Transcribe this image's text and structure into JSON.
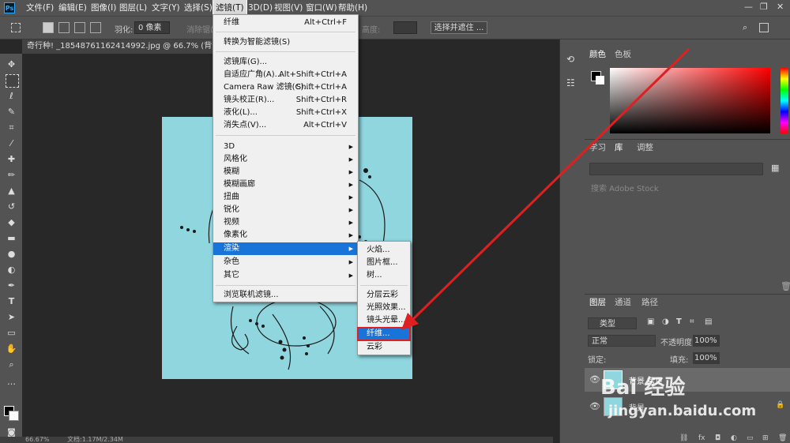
{
  "app": {
    "logo": "Ps"
  },
  "menubar": {
    "items": [
      "文件(F)",
      "编辑(E)",
      "图像(I)",
      "图层(L)",
      "文字(Y)",
      "选择(S)",
      "滤镜(T)",
      "3D(D)",
      "视图(V)",
      "窗口(W)",
      "帮助(H)"
    ],
    "active": "滤镜(T)"
  },
  "options": {
    "feather_label": "羽化:",
    "feather_value": "0 像素",
    "antialias_label": "消除锯齿",
    "style_label": "样式:",
    "width_label": "宽度:",
    "height_label": "高度:",
    "select_mask_button": "选择并遮住 ..."
  },
  "document": {
    "tab_title": "奇行种! _1854876116241499​2.jpg @ 66.7% (背景 拷贝_",
    "zoom": "66.67%",
    "doc_info": "文档:1.17M/2.34M"
  },
  "filter_menu": {
    "top_items": [
      {
        "label": "纤维",
        "shortcut": "Alt+Ctrl+F"
      },
      {
        "label": "转换为智能滤镜(S)",
        "shortcut": ""
      }
    ],
    "gallery_items": [
      {
        "label": "滤镜库(G)...",
        "shortcut": ""
      },
      {
        "label": "自适应广角(A)...",
        "shortcut": "Alt+Shift+Ctrl+A"
      },
      {
        "label": "Camera Raw 滤镜(C)...",
        "shortcut": "Shift+Ctrl+A"
      },
      {
        "label": "镜头校正(R)...",
        "shortcut": "Shift+Ctrl+R"
      },
      {
        "label": "液化(L)...",
        "shortcut": "Shift+Ctrl+X"
      },
      {
        "label": "消失点(V)...",
        "shortcut": "Alt+Ctrl+V"
      }
    ],
    "sub_items": [
      "3D",
      "风格化",
      "模糊",
      "模糊画廊",
      "扭曲",
      "锐化",
      "视频",
      "像素化",
      "渲染",
      "杂色",
      "其它"
    ],
    "highlighted": "渲染",
    "browse": "浏览联机滤镜..."
  },
  "render_submenu": {
    "items": [
      "火焰...",
      "图片框...",
      "树...",
      "分层云彩",
      "光照效果...",
      "镜头光晕...",
      "纤维...",
      "云彩"
    ],
    "highlighted": "纤维..."
  },
  "panels": {
    "color_tabs": [
      "颜色",
      "色板"
    ],
    "library_tabs": [
      "学习",
      "库",
      "调整"
    ],
    "library_search_placeholder": "搜索 Adobe Stock",
    "layer_tabs": [
      "图层",
      "通道",
      "路径"
    ],
    "layer_filter": "类型",
    "blend_mode": "正常",
    "opacity_label": "不透明度:",
    "opacity_value": "100%",
    "lock_label": "锁定:",
    "fill_label": "填充:",
    "fill_value": "100%",
    "layers": [
      {
        "name": "背景 拷贝",
        "locked": false
      },
      {
        "name": "背景",
        "locked": true
      }
    ]
  },
  "watermark": {
    "text": "Bai 经验",
    "url": "jingyan.baidu.com"
  },
  "colors": {
    "highlight": "#1874d8",
    "arrow": "#e02020",
    "canvas": "#8fd6df"
  }
}
